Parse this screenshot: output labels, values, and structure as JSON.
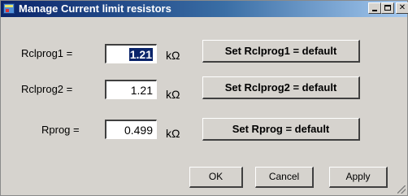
{
  "window": {
    "title": "Manage Current limit resistors"
  },
  "rows": [
    {
      "label": "Rclprog1 =",
      "value": "1.21",
      "unit": "kΩ",
      "button": "Set Rclprog1 = default"
    },
    {
      "label": "Rclprog2 =",
      "value": "1.21",
      "unit": "kΩ",
      "button": "Set Rclprog2 = default"
    },
    {
      "label": "Rprog =",
      "value": "0.499",
      "unit": "kΩ",
      "button": "Set Rprog = default"
    }
  ],
  "footer": {
    "ok": "OK",
    "cancel": "Cancel",
    "apply": "Apply"
  }
}
